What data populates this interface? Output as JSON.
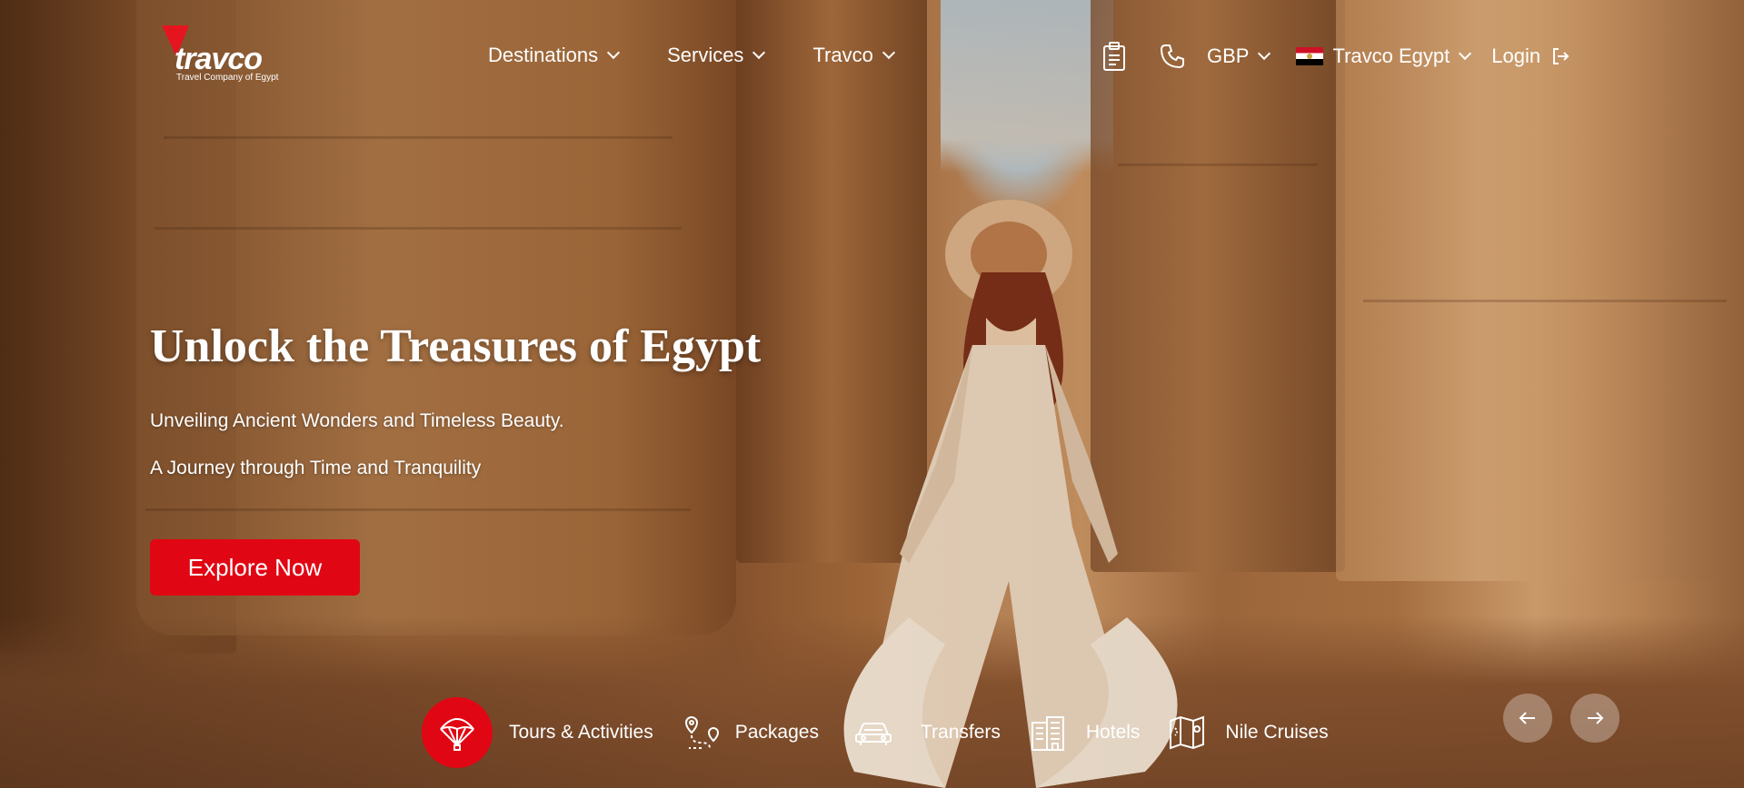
{
  "logo": {
    "word": "travco",
    "tagline": "Travel Company of Egypt"
  },
  "nav": [
    {
      "label": "Destinations"
    },
    {
      "label": "Services"
    },
    {
      "label": "Travco"
    }
  ],
  "utils": {
    "currency": "GBP",
    "region": "Travco Egypt",
    "login": "Login",
    "icons": [
      "clipboard-icon",
      "phone-icon",
      "egypt-flag-icon",
      "login-icon"
    ]
  },
  "hero": {
    "title": "Unlock the Treasures of Egypt",
    "subtitle1": "Unveiling Ancient Wonders and Timeless Beauty.",
    "subtitle2": "A Journey through Time and Tranquility",
    "cta": "Explore Now"
  },
  "categories": [
    {
      "label": "Tours & Activities",
      "icon": "parachute-icon",
      "active": true
    },
    {
      "label": "Packages",
      "icon": "route-pin-icon",
      "active": false
    },
    {
      "label": "Transfers",
      "icon": "car-icon",
      "active": false
    },
    {
      "label": "Hotels",
      "icon": "hotel-building-icon",
      "active": false
    },
    {
      "label": "Nile Cruises",
      "icon": "map-icon",
      "active": false
    }
  ],
  "colors": {
    "accent": "#e10613"
  }
}
